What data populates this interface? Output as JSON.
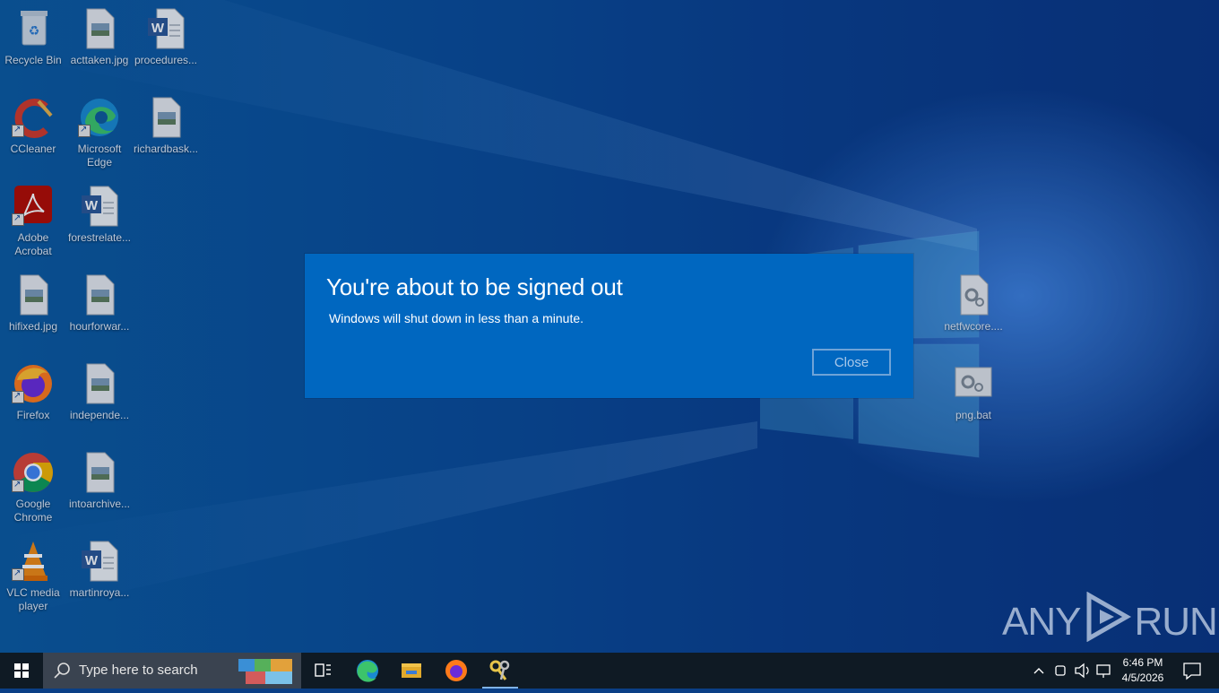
{
  "desktop": {
    "icons": [
      {
        "label": "Recycle Bin",
        "icon": "recycle-bin-icon"
      },
      {
        "label": "acttaken.jpg",
        "icon": "image-file-icon"
      },
      {
        "label": "procedures...",
        "icon": "word-doc-icon"
      },
      {
        "label": "CCleaner",
        "icon": "ccleaner-icon"
      },
      {
        "label": "Microsoft Edge",
        "icon": "edge-icon"
      },
      {
        "label": "richardbask...",
        "icon": "image-file-icon"
      },
      {
        "label": "Adobe Acrobat",
        "icon": "acrobat-icon"
      },
      {
        "label": "forestrelate...",
        "icon": "word-doc-icon"
      },
      {
        "label": "hifixed.jpg",
        "icon": "image-file-icon"
      },
      {
        "label": "hourforwar...",
        "icon": "image-file-icon"
      },
      {
        "label": "Firefox",
        "icon": "firefox-icon"
      },
      {
        "label": "independe...",
        "icon": "image-file-icon"
      },
      {
        "label": "Google Chrome",
        "icon": "chrome-icon"
      },
      {
        "label": "intoarchive...",
        "icon": "image-file-icon"
      },
      {
        "label": "VLC media player",
        "icon": "vlc-icon"
      },
      {
        "label": "martinroya...",
        "icon": "word-doc-icon"
      },
      {
        "label": "netfwcore....",
        "icon": "settings-file-icon"
      },
      {
        "label": "png.bat",
        "icon": "batch-file-icon"
      }
    ]
  },
  "dialog": {
    "title": "You're about to be signed out",
    "message": "Windows will shut down in less than a minute.",
    "close_label": "Close",
    "background": "#0067c0"
  },
  "watermark": {
    "text": "ANY",
    "text2": "RUN"
  },
  "taskbar": {
    "search_placeholder": "Type here to search",
    "apps": [
      "task-view-icon",
      "edge-icon",
      "file-explorer-icon",
      "firefox-icon",
      "keys-tool-icon"
    ],
    "clock_time": "6:46 PM",
    "clock_date": "4/5/2026"
  }
}
